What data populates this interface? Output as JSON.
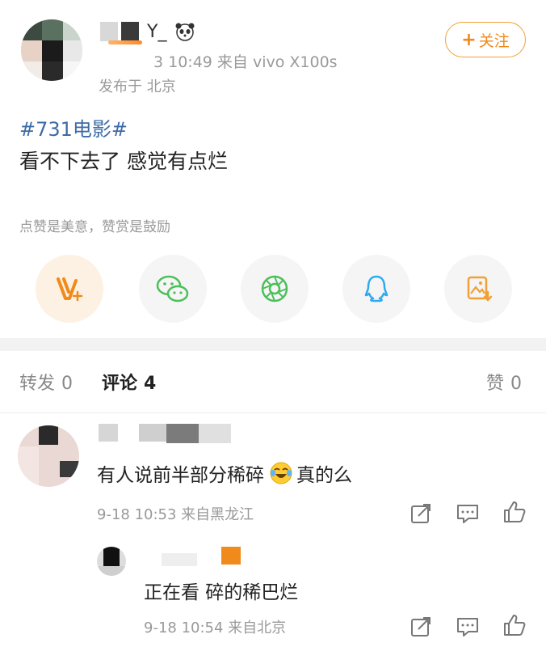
{
  "post": {
    "user_name_suffix": "Y_",
    "meta": "3 10:49  来自 vivo X100s",
    "location": "发布于 北京",
    "follow_label": "关注",
    "hashtag": "#731电影#",
    "text": "看不下去了 感觉有点烂",
    "reward_hint": "点赞是美意，赞赏是鼓励"
  },
  "share": {
    "items": [
      {
        "icon": "reward-v-icon",
        "color": "#f08a1a"
      },
      {
        "icon": "wechat-icon",
        "color": "#4bbf5a"
      },
      {
        "icon": "moments-icon",
        "color": "#4bbf5a"
      },
      {
        "icon": "qq-icon",
        "color": "#2eaaf0"
      },
      {
        "icon": "save-image-icon",
        "color": "#f2a035"
      }
    ]
  },
  "tabs": {
    "repost_label": "转发",
    "repost_count": "0",
    "comment_label": "评论",
    "comment_count": "4",
    "like_label": "赞",
    "like_count": "0"
  },
  "comments": [
    {
      "text_before": "有人说前半部分稀碎",
      "emoji": "laugh-cry-icon",
      "text_after": " 真的么",
      "meta": "9-18 10:53  来自黑龙江"
    }
  ],
  "reply": {
    "text": "正在看 碎的稀巴烂",
    "meta": "9-18 10:54  来自北京"
  },
  "colors": {
    "accent": "#f08a1a",
    "link": "#3d6ba6",
    "muted": "#999999"
  }
}
